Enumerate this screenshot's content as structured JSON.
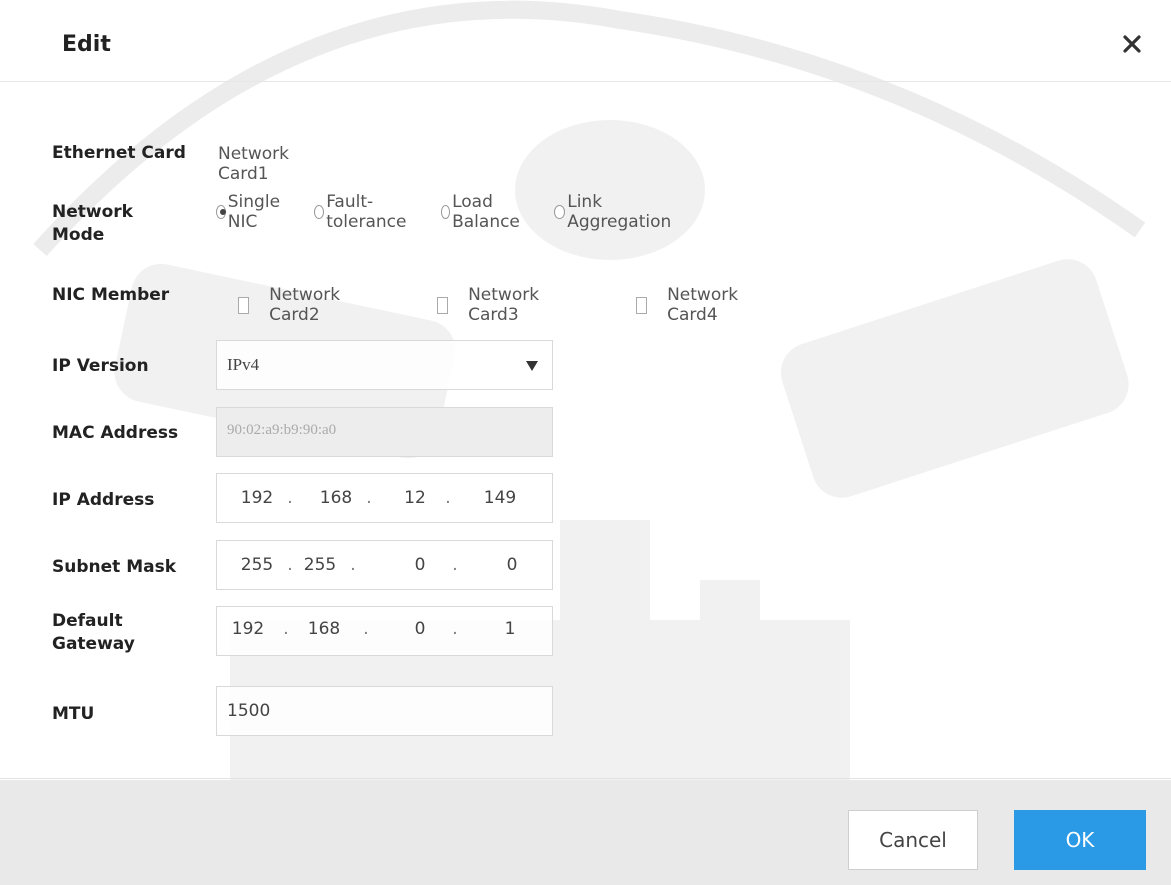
{
  "dialog": {
    "title": "Edit",
    "close_icon": "close-icon"
  },
  "ethernet_card": {
    "label": "Ethernet Card",
    "value": "Network Card1"
  },
  "network_mode": {
    "label": "Network Mode",
    "options": [
      "Single NIC",
      "Fault-tolerance",
      "Load Balance",
      "Link Aggregation"
    ],
    "selected": "Single NIC"
  },
  "nic_member": {
    "label": "NIC Member",
    "members": [
      "Network Card2",
      "Network Card3",
      "Network Card4"
    ]
  },
  "ip_version": {
    "label": "IP Version",
    "value": "IPv4"
  },
  "mac_address": {
    "label": "MAC Address",
    "value": "90:02:a9:b9:90:a0"
  },
  "ip_address": {
    "label": "IP Address",
    "octets": [
      "192",
      "168",
      "12",
      "149"
    ]
  },
  "subnet_mask": {
    "label": "Subnet Mask",
    "octets": [
      "255",
      "255",
      "0",
      "0"
    ]
  },
  "default_gateway": {
    "label": "Default Gateway",
    "octets": [
      "192",
      "168",
      "0",
      "1"
    ]
  },
  "mtu": {
    "label": "MTU",
    "value": "1500"
  },
  "buttons": {
    "cancel": "Cancel",
    "ok": "OK"
  },
  "colors": {
    "ok_button": "#2b9ae6",
    "disabled_field": "#ededed"
  }
}
